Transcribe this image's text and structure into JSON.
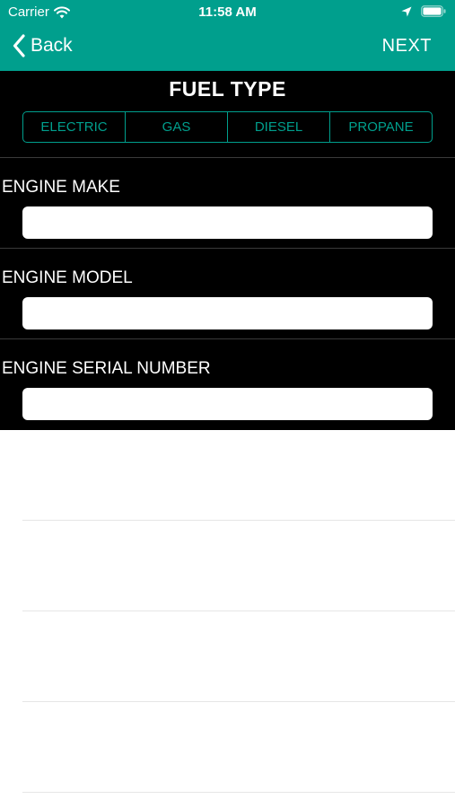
{
  "status_bar": {
    "carrier": "Carrier",
    "time": "11:58 AM"
  },
  "nav": {
    "back_label": "Back",
    "next_label": "NEXT"
  },
  "fuel": {
    "title": "FUEL TYPE",
    "options": [
      "ELECTRIC",
      "GAS",
      "DIESEL",
      "PROPANE"
    ]
  },
  "fields": [
    {
      "label": "ENGINE MAKE",
      "value": ""
    },
    {
      "label": "ENGINE MODEL",
      "value": ""
    },
    {
      "label": "ENGINE SERIAL NUMBER",
      "value": ""
    }
  ],
  "colors": {
    "accent": "#009f8d",
    "panel_background": "#000000",
    "page_background": "#ffffff"
  },
  "icons": [
    "wifi-icon",
    "location-icon",
    "battery-icon",
    "back-chevron-icon"
  ]
}
